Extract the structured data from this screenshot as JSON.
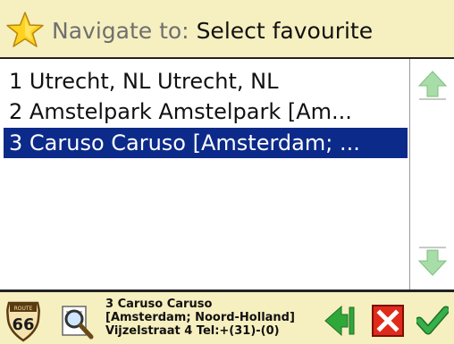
{
  "header": {
    "icon": "star-icon",
    "prefix": "Navigate to:",
    "title": "Select favourite"
  },
  "favourites": [
    {
      "label": "1 Utrecht, NL Utrecht, NL",
      "selected": false
    },
    {
      "label": "2 Amstelpark  Amstelpark [Am...",
      "selected": false
    },
    {
      "label": "3 Caruso  Caruso [Amsterdam; ...",
      "selected": true
    }
  ],
  "scrollbar": {
    "up_icon": "arrow-up-icon",
    "down_icon": "arrow-down-icon"
  },
  "footer": {
    "route_badge": {
      "top": "ROUTE",
      "number": "66"
    },
    "info_lines": [
      "3 Caruso  Caruso",
      "[Amsterdam; Noord-Holland]",
      "Vijzelstraat 4 Tel:+(31)-(0)"
    ],
    "buttons": [
      "back-arrow-icon",
      "cancel-x-icon",
      "confirm-check-icon"
    ]
  },
  "colors": {
    "header_bg": "#f6efbf",
    "selection": "#0c2a8a",
    "arrow_green": "#8fd08f",
    "back_green": "#2fa83a",
    "cancel_red": "#e02a1a",
    "check_green": "#37b04a"
  }
}
